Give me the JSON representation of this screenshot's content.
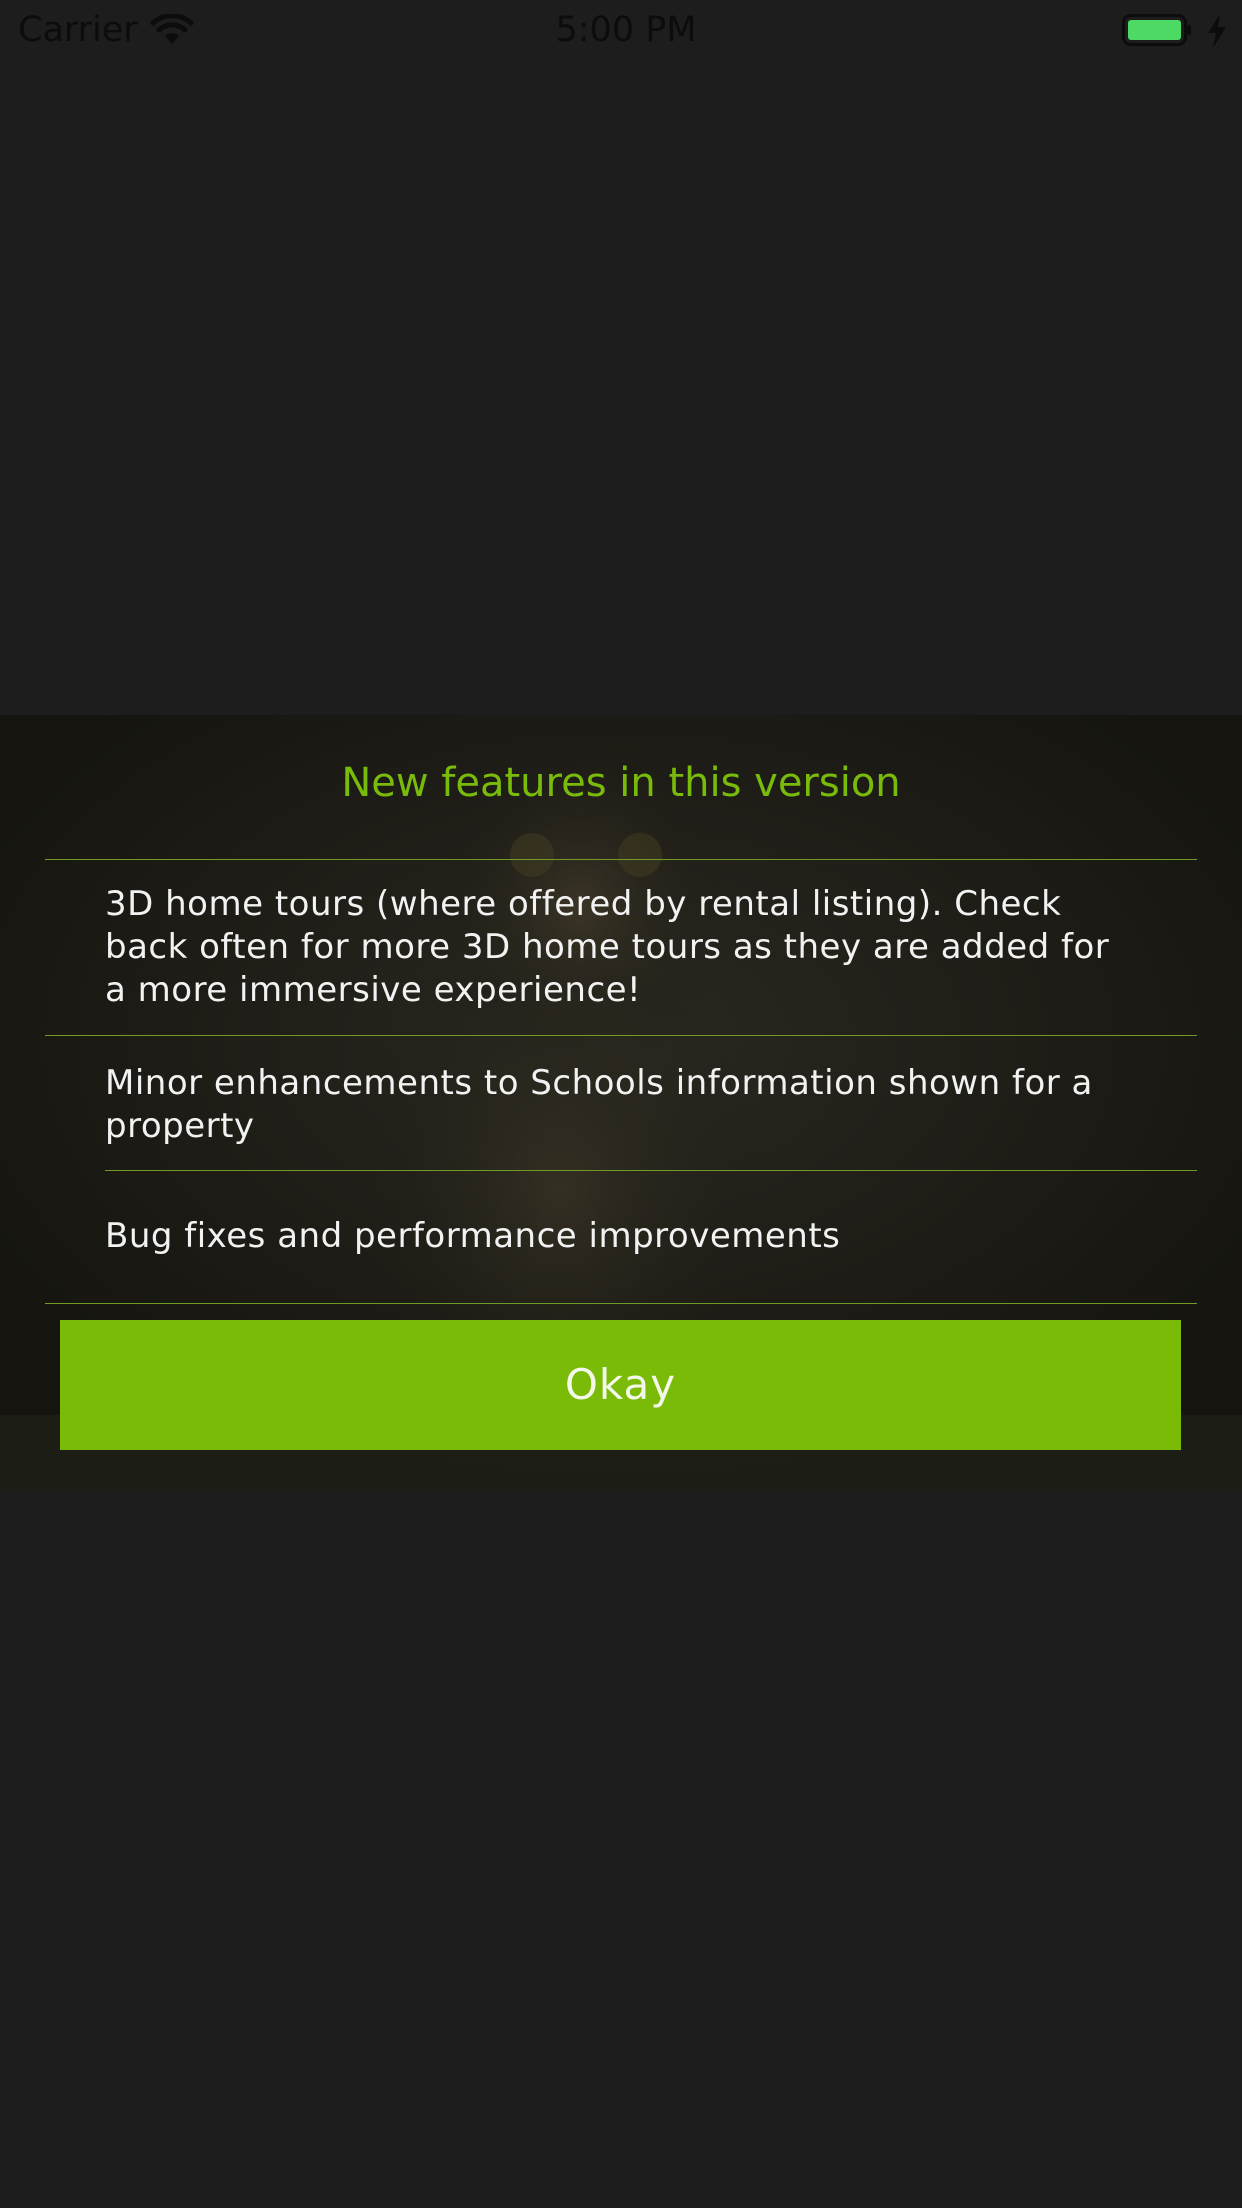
{
  "status_bar": {
    "carrier": "Carrier",
    "time": "5:00 PM",
    "wifi_icon": "wifi-icon",
    "battery_icon": "battery-icon",
    "charging_icon": "charging-bolt-icon",
    "battery_color": "#4cd964"
  },
  "dialog": {
    "title": "New features in this version",
    "features": [
      "3D home tours (where offered by rental listing). Check back often for more 3D home tours as they are added for a more immersive experience!",
      "Minor enhancements to Schools information shown for a property",
      "Bug fixes and performance improvements"
    ],
    "okay_label": "Okay",
    "accent_color": "#79bb06"
  }
}
